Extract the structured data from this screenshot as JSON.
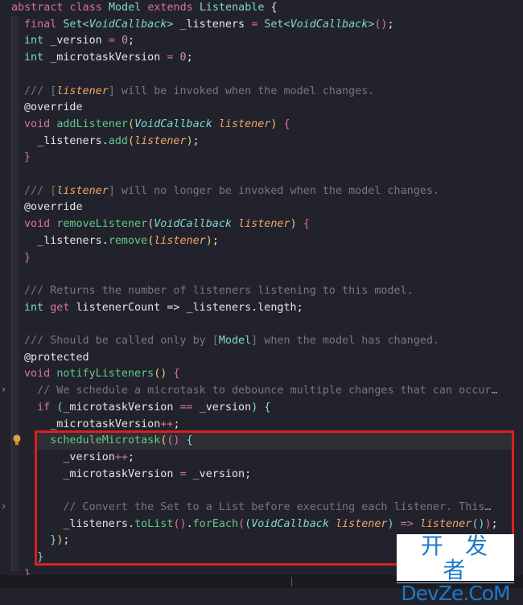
{
  "editor": {
    "language": "Dart",
    "lines": [
      {
        "id": "l1",
        "tokens": [
          [
            "kw",
            "abstract class "
          ],
          [
            "type",
            "Model "
          ],
          [
            "kw",
            "extends "
          ],
          [
            "type",
            "Listenable "
          ],
          [
            "punc",
            "{"
          ]
        ]
      },
      {
        "id": "l2",
        "tokens": [
          [
            "kw",
            "final "
          ],
          [
            "type",
            "Set<"
          ],
          [
            "type ital",
            "VoidCallback"
          ],
          [
            "type",
            "> "
          ],
          [
            "punc",
            "_listeners "
          ],
          [
            "op",
            "= "
          ],
          [
            "type",
            "Set<"
          ],
          [
            "type ital",
            "VoidCallback"
          ],
          [
            "type",
            ">"
          ],
          [
            "brace-p",
            "()"
          ],
          [
            "punc",
            ";"
          ]
        ]
      },
      {
        "id": "l3",
        "tokens": [
          [
            "type",
            "int "
          ],
          [
            "punc",
            "_version "
          ],
          [
            "op",
            "= "
          ],
          [
            "num",
            "0"
          ],
          [
            "punc",
            ";"
          ]
        ]
      },
      {
        "id": "l4",
        "tokens": [
          [
            "type",
            "int "
          ],
          [
            "punc",
            "_microtaskVersion "
          ],
          [
            "op",
            "= "
          ],
          [
            "num",
            "0"
          ],
          [
            "punc",
            ";"
          ]
        ]
      },
      {
        "id": "l5",
        "tokens": []
      },
      {
        "id": "l6",
        "tokens": [
          [
            "cm",
            "/// ["
          ],
          [
            "cm-ref",
            "listener"
          ],
          [
            "cm",
            "] will be invoked when the model changes."
          ]
        ]
      },
      {
        "id": "l7",
        "tokens": [
          [
            "anno",
            "@override"
          ]
        ]
      },
      {
        "id": "l8",
        "tokens": [
          [
            "kw",
            "void "
          ],
          [
            "fn",
            "addListener"
          ],
          [
            "brace-y",
            "("
          ],
          [
            "type ital",
            "VoidCallback "
          ],
          [
            "param",
            "listener"
          ],
          [
            "brace-y",
            ") "
          ],
          [
            "brace-p",
            "{"
          ]
        ]
      },
      {
        "id": "l9",
        "tokens": [
          [
            "punc",
            "  _listeners."
          ],
          [
            "fn",
            "add"
          ],
          [
            "brace-y",
            "("
          ],
          [
            "param",
            "listener"
          ],
          [
            "brace-y",
            ")"
          ],
          [
            "punc",
            ";"
          ]
        ]
      },
      {
        "id": "l10",
        "tokens": [
          [
            "brace-p",
            "}"
          ]
        ]
      },
      {
        "id": "l11",
        "tokens": []
      },
      {
        "id": "l12",
        "tokens": [
          [
            "cm",
            "/// ["
          ],
          [
            "cm-ref",
            "listener"
          ],
          [
            "cm",
            "] will no longer be invoked when the model changes."
          ]
        ]
      },
      {
        "id": "l13",
        "tokens": [
          [
            "anno",
            "@override"
          ]
        ]
      },
      {
        "id": "l14",
        "tokens": [
          [
            "kw",
            "void "
          ],
          [
            "fn",
            "removeListener"
          ],
          [
            "brace-y",
            "("
          ],
          [
            "type ital",
            "VoidCallback "
          ],
          [
            "param",
            "listener"
          ],
          [
            "brace-y",
            ") "
          ],
          [
            "brace-p",
            "{"
          ]
        ]
      },
      {
        "id": "l15",
        "tokens": [
          [
            "punc",
            "  _listeners."
          ],
          [
            "fn",
            "remove"
          ],
          [
            "brace-y",
            "("
          ],
          [
            "param",
            "listener"
          ],
          [
            "brace-y",
            ")"
          ],
          [
            "punc",
            ";"
          ]
        ]
      },
      {
        "id": "l16",
        "tokens": [
          [
            "brace-p",
            "}"
          ]
        ]
      },
      {
        "id": "l17",
        "tokens": []
      },
      {
        "id": "l18",
        "tokens": [
          [
            "cm",
            "/// Returns the number of listeners listening to this model."
          ]
        ]
      },
      {
        "id": "l19",
        "tokens": [
          [
            "type",
            "int "
          ],
          [
            "kw",
            "get "
          ],
          [
            "punc",
            "listenerCount => _listeners.length;"
          ]
        ]
      },
      {
        "id": "l20",
        "tokens": []
      },
      {
        "id": "l21",
        "tokens": [
          [
            "cm",
            "/// Should be called only by ["
          ],
          [
            "cm-ref-type",
            "Model"
          ],
          [
            "cm",
            "] when the model has changed."
          ]
        ]
      },
      {
        "id": "l22",
        "tokens": [
          [
            "anno",
            "@protected"
          ]
        ]
      },
      {
        "id": "l23",
        "tokens": [
          [
            "kw",
            "void "
          ],
          [
            "fn",
            "notifyListeners"
          ],
          [
            "brace-y",
            "() "
          ],
          [
            "brace-p",
            "{"
          ]
        ]
      },
      {
        "id": "l24",
        "tokens": [
          [
            "cm",
            "  // We schedule a microtask to debounce multiple changes that can occur"
          ],
          [
            "fold",
            "…"
          ]
        ]
      },
      {
        "id": "l25",
        "tokens": [
          [
            "kw",
            "  if "
          ],
          [
            "brace-b",
            "("
          ],
          [
            "punc",
            "_microtaskVersion "
          ],
          [
            "op",
            "== "
          ],
          [
            "punc",
            "_version"
          ],
          [
            "brace-b",
            ") "
          ],
          [
            "brace-b",
            "{"
          ]
        ]
      },
      {
        "id": "l26",
        "tokens": [
          [
            "punc",
            "    _microtaskVersion"
          ],
          [
            "op",
            "++"
          ],
          [
            "punc",
            ";"
          ]
        ]
      },
      {
        "id": "l27",
        "tokens": [
          [
            "fn",
            "    scheduleMicrotask"
          ],
          [
            "brace-y",
            "("
          ],
          [
            "brace-p",
            "() "
          ],
          [
            "brace-b",
            "{"
          ]
        ]
      },
      {
        "id": "l28",
        "tokens": [
          [
            "punc",
            "      _version"
          ],
          [
            "op",
            "++"
          ],
          [
            "punc",
            ";"
          ]
        ]
      },
      {
        "id": "l29",
        "tokens": [
          [
            "punc",
            "      _microtaskVersion "
          ],
          [
            "op",
            "= "
          ],
          [
            "punc",
            "_version;"
          ]
        ]
      },
      {
        "id": "l30",
        "tokens": []
      },
      {
        "id": "l31",
        "tokens": [
          [
            "cm",
            "      // Convert the Set to a List before executing each listener. This"
          ],
          [
            "fold",
            "…"
          ]
        ]
      },
      {
        "id": "l32",
        "tokens": [
          [
            "punc",
            "      _listeners."
          ],
          [
            "fn",
            "toList"
          ],
          [
            "brace-p",
            "()"
          ],
          [
            "punc",
            "."
          ],
          [
            "fn",
            "forEach"
          ],
          [
            "brace-p",
            "("
          ],
          [
            "brace-b",
            "("
          ],
          [
            "type ital",
            "VoidCallback "
          ],
          [
            "param",
            "listener"
          ],
          [
            "brace-b",
            ") "
          ],
          [
            "op",
            "=> "
          ],
          [
            "param",
            "listener"
          ],
          [
            "brace-b",
            "()"
          ],
          [
            "brace-p",
            ")"
          ],
          [
            "punc",
            ";"
          ]
        ]
      },
      {
        "id": "l33",
        "tokens": [
          [
            "brace-b",
            "    }"
          ],
          [
            "brace-y",
            ")"
          ],
          [
            "punc",
            ";"
          ]
        ]
      },
      {
        "id": "l34",
        "tokens": [
          [
            "brace-b",
            "  }"
          ]
        ]
      },
      {
        "id": "l35",
        "tokens": [
          [
            "brace-p",
            "}"
          ]
        ]
      }
    ]
  },
  "gutter": {
    "fold_markers": [
      24,
      31
    ],
    "lightbulb_line": 27,
    "lightbulb_icon": "lightbulb-icon",
    "fold_icon": "chevron-right-icon"
  },
  "highlight": {
    "label": "scheduleMicrotask block",
    "color": "#d8211e"
  },
  "watermark": {
    "cn": "开 发 者",
    "en": "DevZe.CoM"
  },
  "colors": {
    "background": "#22222c",
    "keyword": "#d9739b",
    "type": "#7fd7d0",
    "function": "#63c98a",
    "parameter": "#f0a86a",
    "comment": "#77777f"
  }
}
